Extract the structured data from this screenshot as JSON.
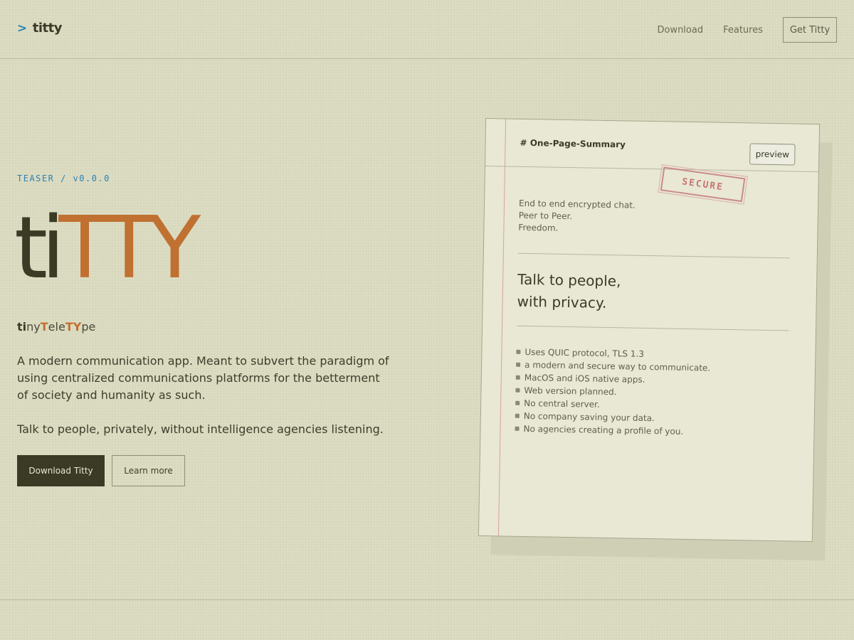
{
  "header": {
    "brand_prompt": ">",
    "brand_name": "titty",
    "nav": {
      "download": "Download",
      "features": "Features",
      "cta": "Get Titty"
    }
  },
  "hero": {
    "teaser": "TEASER / v0.0.0",
    "logo": {
      "part_dark": "ti",
      "part_orange": "TTY"
    },
    "tagline": {
      "seg1": "ti",
      "seg2": "ny",
      "seg3": "T",
      "seg4": "ele",
      "seg5": "TY",
      "seg6": "pe"
    },
    "description": "A modern communication app. Meant to subvert the paradigm of using centralized communications platforms for the betterment of society and humanity as such.",
    "description2": "Talk to people, privately, without intelligence agencies listening.",
    "buttons": {
      "primary": "Download Titty",
      "secondary": "Learn more"
    }
  },
  "card": {
    "title": "# One-Page-Summary",
    "preview": "preview",
    "stamp": "SECURE",
    "intro": [
      "End to end encrypted chat.",
      "Peer to Peer.",
      "Freedom."
    ],
    "headline": [
      "Talk to people,",
      "with privacy."
    ],
    "features": [
      "Uses QUIC protocol, TLS 1.3",
      "a modern and secure way to communicate.",
      "MacOS and iOS native apps.",
      "Web version planned.",
      "No central server.",
      "No company saving your data.",
      "No agencies creating a profile of you."
    ]
  },
  "colors": {
    "background": "#dcdcc2",
    "accent_blue": "#2d82b5",
    "accent_orange": "#c07030",
    "dark": "#3b3b25",
    "stamp_red": "#c46868"
  }
}
